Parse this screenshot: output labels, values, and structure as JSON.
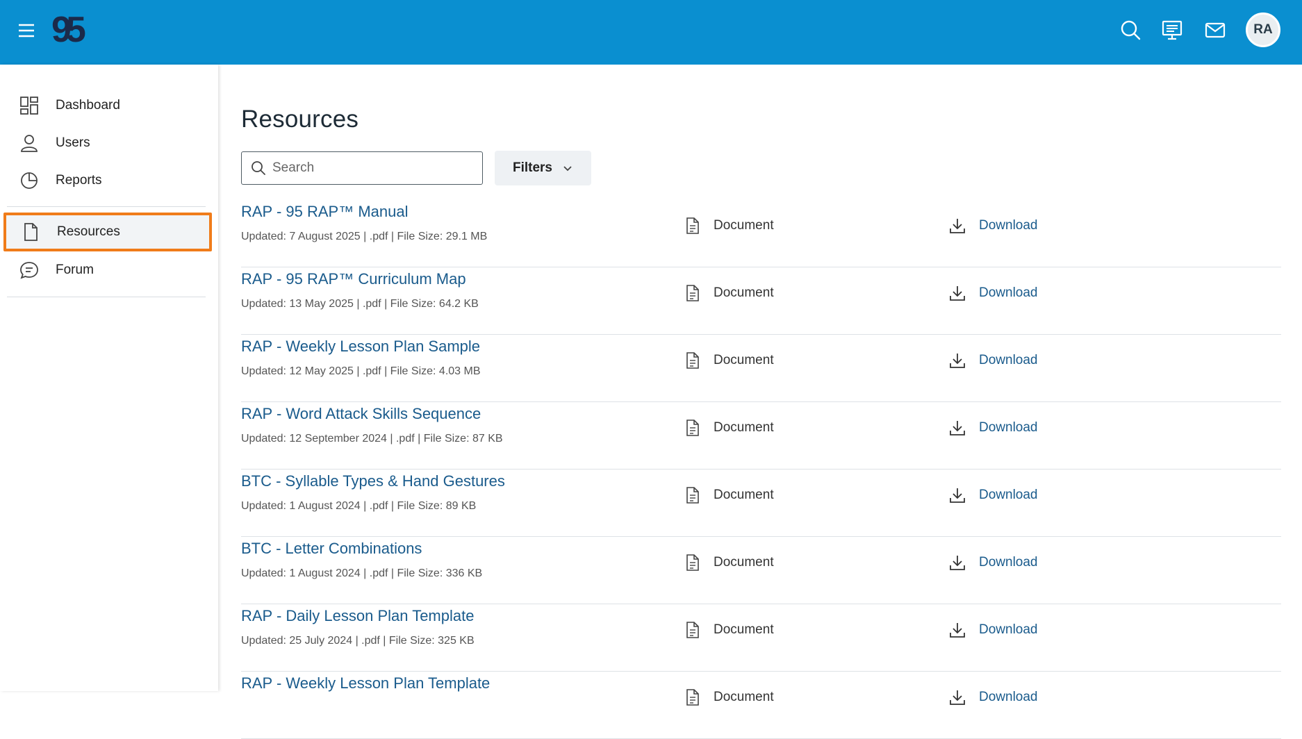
{
  "header": {
    "logo_text": "95",
    "avatar_initials": "RA",
    "icons": [
      "menu-icon",
      "search-icon",
      "presentation-icon",
      "mail-icon"
    ]
  },
  "sidebar": {
    "items": [
      {
        "label": "Dashboard",
        "icon": "dashboard-icon"
      },
      {
        "label": "Users",
        "icon": "user-icon"
      },
      {
        "label": "Reports",
        "icon": "pie-chart-icon"
      },
      {
        "label": "Resources",
        "icon": "document-icon",
        "active": true
      },
      {
        "label": "Forum",
        "icon": "chat-icon"
      }
    ]
  },
  "main": {
    "title": "Resources",
    "search": {
      "placeholder": "Search",
      "value": ""
    },
    "filters_label": "Filters"
  },
  "resources": [
    {
      "title": "RAP - 95 RAP™ Manual",
      "meta": "Updated: 7 August 2025 | .pdf | File Size: 29.1 MB",
      "type": "Document",
      "action": "Download"
    },
    {
      "title": "RAP - 95 RAP™ Curriculum Map",
      "meta": "Updated: 13 May 2025 | .pdf | File Size: 64.2 KB",
      "type": "Document",
      "action": "Download"
    },
    {
      "title": "RAP - Weekly Lesson Plan Sample",
      "meta": "Updated: 12 May 2025 | .pdf | File Size: 4.03 MB",
      "type": "Document",
      "action": "Download"
    },
    {
      "title": "RAP - Word Attack Skills Sequence",
      "meta": "Updated: 12 September 2024 | .pdf | File Size: 87 KB",
      "type": "Document",
      "action": "Download"
    },
    {
      "title": "BTC - Syllable Types & Hand Gestures",
      "meta": "Updated: 1 August 2024 | .pdf | File Size: 89 KB",
      "type": "Document",
      "action": "Download"
    },
    {
      "title": "BTC - Letter Combinations",
      "meta": "Updated: 1 August 2024 | .pdf | File Size: 336 KB",
      "type": "Document",
      "action": "Download"
    },
    {
      "title": "RAP - Daily Lesson Plan Template",
      "meta": "Updated: 25 July 2024 | .pdf | File Size: 325 KB",
      "type": "Document",
      "action": "Download"
    },
    {
      "title": "RAP - Weekly Lesson Plan Template",
      "meta": "",
      "type": "Document",
      "action": "Download"
    }
  ],
  "colors": {
    "header_bg": "#0a8fd0",
    "active_outline": "#f07c1a",
    "link": "#1a5b8c"
  }
}
